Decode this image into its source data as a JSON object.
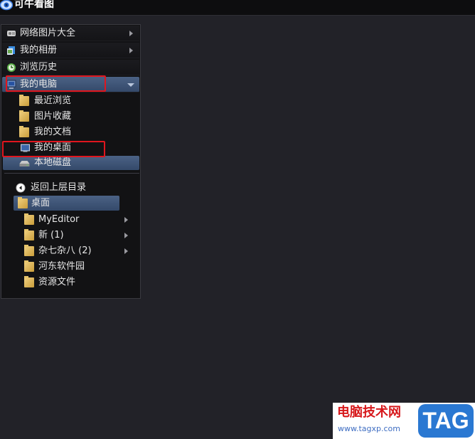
{
  "app": {
    "title": "可牛看图"
  },
  "nav": {
    "items": [
      {
        "label": "网络图片大全",
        "icon": "web-gallery-icon",
        "has_submenu": true
      },
      {
        "label": "我的相册",
        "icon": "album-icon",
        "has_submenu": true
      },
      {
        "label": "浏览历史",
        "icon": "history-icon",
        "has_submenu": false
      },
      {
        "label": "我的电脑",
        "icon": "computer-icon",
        "expanded": true
      }
    ],
    "computer_children": [
      {
        "label": "最近浏览",
        "icon": "recent-folder-icon"
      },
      {
        "label": "图片收藏",
        "icon": "favorites-folder-icon"
      },
      {
        "label": "我的文档",
        "icon": "documents-folder-icon"
      },
      {
        "label": "我的桌面",
        "icon": "desktop-icon"
      },
      {
        "label": "本地磁盘",
        "icon": "disk-icon",
        "selected": true
      }
    ]
  },
  "tree": {
    "back_label": "返回上层目录",
    "current_label": "桌面",
    "folders": [
      {
        "label": "MyEditor",
        "has_children": true
      },
      {
        "label": "新 (1)",
        "has_children": true
      },
      {
        "label": "杂七杂八 (2)",
        "has_children": true
      },
      {
        "label": "河东软件园",
        "has_children": false
      },
      {
        "label": "资源文件",
        "has_children": false
      }
    ]
  },
  "watermark": {
    "title": "电脑技术网",
    "url": "www.tagxp.com",
    "tag": "TAG"
  },
  "colors": {
    "background": "#222228",
    "panel": "#121214",
    "selection": "#3f5578",
    "highlight_box": "#e0161e",
    "watermark_tag": "#2a78d2"
  }
}
